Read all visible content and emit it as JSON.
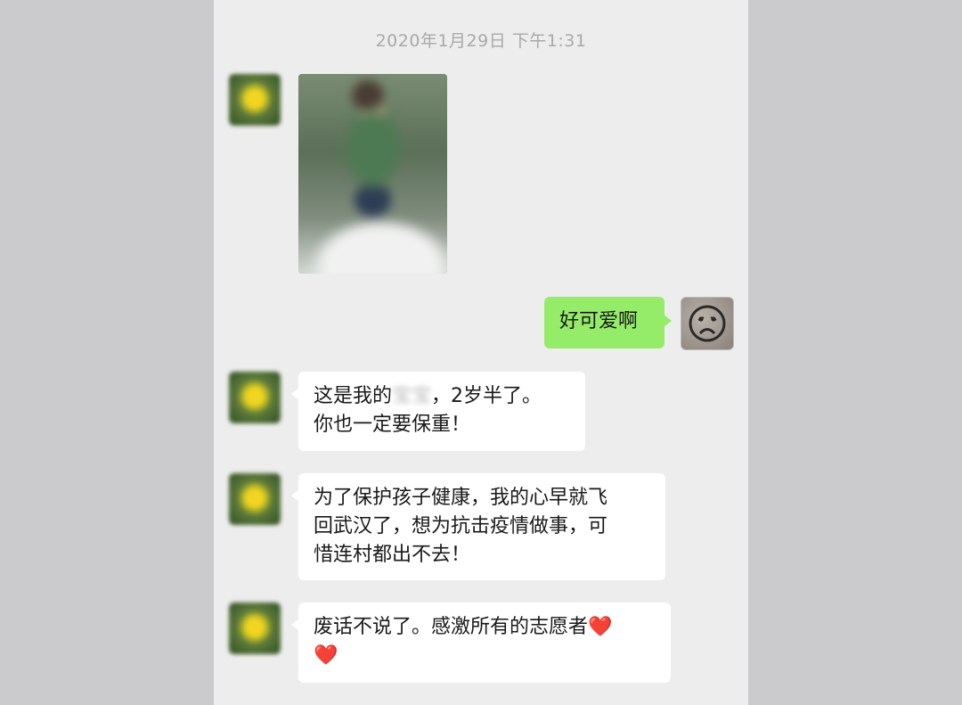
{
  "timestamp": "2020年1月29日 下午1:31",
  "icons": {
    "contact_avatar": "flower-avatar",
    "self_avatar": "sad-face-avatar",
    "heart": "orange-heart-emoji"
  },
  "messages": [
    {
      "sender": "contact",
      "type": "image",
      "description_icon": "photo-blurred"
    },
    {
      "sender": "self",
      "type": "text",
      "text": "好可爱啊"
    },
    {
      "sender": "contact",
      "type": "text",
      "prefix": "这是我的",
      "redacted": "宝宝",
      "suffix": "，2岁半了。",
      "line2": "你也一定要保重！"
    },
    {
      "sender": "contact",
      "type": "text",
      "line1": "为了保护孩子健康，我的心早就飞",
      "line2": "回武汉了，想为抗击疫情做事，可",
      "line3": "惜连村都出不去！"
    },
    {
      "sender": "contact",
      "type": "text",
      "line1": "废话不说了。感激所有的志愿者",
      "emoji": "❤️"
    }
  ],
  "colors": {
    "chat_bg": "#ededed",
    "outer_bg": "#cbcbcd",
    "self_bubble": "#95ec69",
    "contact_bubble": "#ffffff",
    "heart": "#f05a24"
  }
}
